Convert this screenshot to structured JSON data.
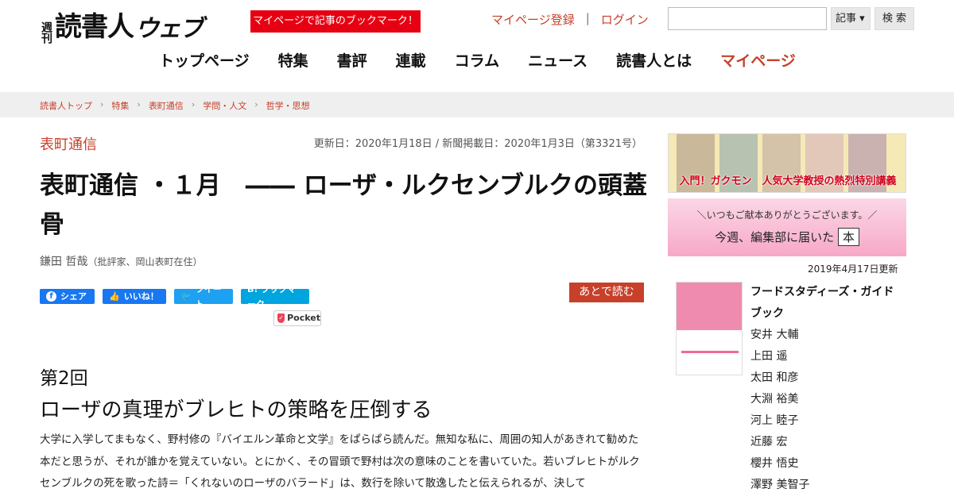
{
  "header": {
    "logo_small": "週刊",
    "logo_main": "読書人",
    "logo_web": "ウェブ",
    "bookmark_promo": "マイページで記事のブックマーク！",
    "mypage_register": "マイページ登録",
    "separator": "|",
    "login": "ログイン",
    "search_select": "記事 ▾",
    "search_button": "検 索"
  },
  "nav": [
    "トップページ",
    "特集",
    "書評",
    "連載",
    "コラム",
    "ニュース",
    "読書人とは",
    "マイページ"
  ],
  "breadcrumb": [
    "読書人トップ",
    "特集",
    "表町通信",
    "学問・人文",
    "哲学・思想"
  ],
  "article": {
    "category": "表町通信",
    "dates": "更新日：2020年1月18日 / 新聞掲載日：2020年1月3日（第3321号）",
    "title": "表町通信 ・１月　―― ローザ・ルクセンブルクの頭蓋骨",
    "author_name": "鎌田 哲哉",
    "author_note": "（批評家、岡山表町在住）",
    "kai": "第2回",
    "subtitle": "ローザの真理がブレヒトの策略を圧倒する",
    "body": "大学に入学してまもなく、野村修の『バイエルン革命と文学』をぱらぱら読んだ。無知な私に、周囲の知人があきれて勧めた本だと思うが、それが誰かを覚えていない。とにかく、その冒頭で野村は次の意味のことを書いていた。若いブレヒトがルクセンブルクの死を歌った詩＝「くれないのローザのバラード」は、数行を除いて散逸したと伝えられるが、決して"
  },
  "share": {
    "facebook": "シェア",
    "like": "いいね！",
    "tweet": "ツイート",
    "hatena": "B! ブックマーク",
    "pocket": "Pocket",
    "later": "あとで読む"
  },
  "sidebar": {
    "banner1_caption": "入門！ガクモン　人気大学教授の熱烈特別講義",
    "banner2_line1": "＼いつもご献本ありがとうございます。／",
    "banner2_line2": "今週、編集部に届いた",
    "banner2_hon": "本",
    "updated": "2019年4月17日更新",
    "book_title": "フードスタディーズ・ガイドブック",
    "authors": [
      "安井 大輔",
      "上田 遥",
      "太田 和彦",
      "大淵 裕美",
      "河上 睦子",
      "近藤 宏",
      "櫻井 悟史",
      "澤野 美智子"
    ]
  },
  "colors": {
    "accent": "#c7402a",
    "promo_red": "#e60012",
    "facebook": "#1877f2",
    "twitter": "#1da1f2",
    "hatena": "#00a4de"
  }
}
